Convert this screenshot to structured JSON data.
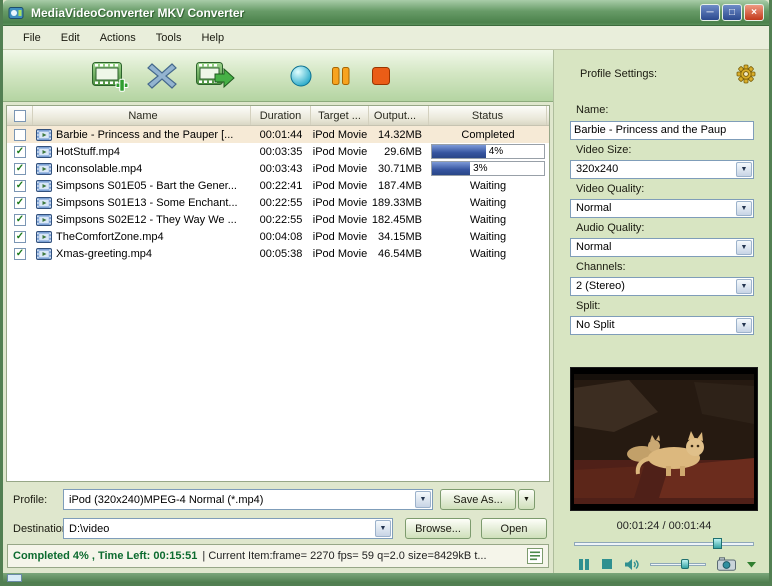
{
  "window": {
    "title": "MediaVideoConverter MKV Converter"
  },
  "icons": {
    "minimize": "─",
    "maximize": "□",
    "close": "×",
    "dropdown_arrow": "▼",
    "check": "✓"
  },
  "menu": {
    "items": [
      {
        "label": "File"
      },
      {
        "label": "Edit"
      },
      {
        "label": "Actions"
      },
      {
        "label": "Tools"
      },
      {
        "label": "Help"
      }
    ]
  },
  "table": {
    "columns": {
      "check": "",
      "name": "Name",
      "duration": "Duration",
      "target": "Target ...",
      "output": "Output...",
      "status": "Status"
    },
    "rows": [
      {
        "checked": false,
        "selected": true,
        "name": "Barbie - Princess and the Pauper [...",
        "duration": "00:01:44",
        "target": "iPod Movie",
        "output": "14.32MB",
        "status": {
          "type": "text",
          "value": "Completed"
        }
      },
      {
        "checked": true,
        "selected": false,
        "name": "HotStuff.mp4",
        "duration": "00:03:35",
        "target": "iPod Movie",
        "output": "29.6MB",
        "status": {
          "type": "progress",
          "fill": 48,
          "label": "4%"
        }
      },
      {
        "checked": true,
        "selected": false,
        "name": "Inconsolable.mp4",
        "duration": "00:03:43",
        "target": "iPod Movie",
        "output": "30.71MB",
        "status": {
          "type": "progress",
          "fill": 34,
          "label": "3%"
        }
      },
      {
        "checked": true,
        "selected": false,
        "name": "Simpsons S01E05 - Bart the Gener...",
        "duration": "00:22:41",
        "target": "iPod Movie",
        "output": "187.4MB",
        "status": {
          "type": "text",
          "value": "Waiting"
        }
      },
      {
        "checked": true,
        "selected": false,
        "name": "Simpsons S01E13 - Some Enchant...",
        "duration": "00:22:55",
        "target": "iPod Movie",
        "output": "189.33MB",
        "status": {
          "type": "text",
          "value": "Waiting"
        }
      },
      {
        "checked": true,
        "selected": false,
        "name": "Simpsons S02E12 - They Way We ...",
        "duration": "00:22:55",
        "target": "iPod Movie",
        "output": "182.45MB",
        "status": {
          "type": "text",
          "value": "Waiting"
        }
      },
      {
        "checked": true,
        "selected": false,
        "name": "TheComfortZone.mp4",
        "duration": "00:04:08",
        "target": "iPod Movie",
        "output": "34.15MB",
        "status": {
          "type": "text",
          "value": "Waiting"
        }
      },
      {
        "checked": true,
        "selected": false,
        "name": "Xmas-greeting.mp4",
        "duration": "00:05:38",
        "target": "iPod Movie",
        "output": "46.54MB",
        "status": {
          "type": "text",
          "value": "Waiting"
        }
      }
    ]
  },
  "profile_panel": {
    "title": "Profile Settings:",
    "name_label": "Name:",
    "name_value": "Barbie - Princess and the Paup",
    "video_size_label": "Video Size:",
    "video_size_value": "320x240",
    "video_quality_label": "Video Quality:",
    "video_quality_value": "Normal",
    "audio_quality_label": "Audio Quality:",
    "audio_quality_value": "Normal",
    "channels_label": "Channels:",
    "channels_value": "2 (Stereo)",
    "split_label": "Split:",
    "split_value": "No Split"
  },
  "player": {
    "time": "00:01:24 / 00:01:44"
  },
  "bottom": {
    "profile_label": "Profile:",
    "profile_value": "iPod (320x240)MPEG-4 Normal (*.mp4)",
    "save_as_label": "Save As...",
    "destination_label": "Destination:",
    "destination_value": "D:\\video",
    "browse_label": "Browse...",
    "open_label": "Open"
  },
  "status_bar": {
    "left_bold": "Completed 4% , Time Left: 00:15:51",
    "detail": "| Current Item:frame= 2270 fps= 59 q=2.0 size=8429kB t..."
  }
}
